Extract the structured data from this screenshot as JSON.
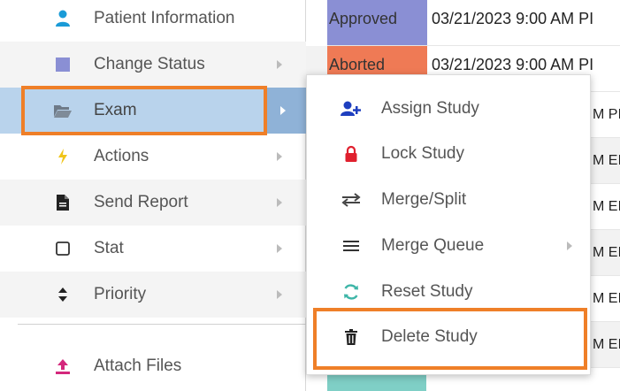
{
  "colors": {
    "approved": "#8a8fd4",
    "aborted": "#ef7a55",
    "active_item": "#b9d3ec",
    "highlight": "#ef7f28",
    "teal": "#7fcfc6"
  },
  "grid": {
    "rows": [
      {
        "status": "Approved",
        "date": "03/21/2023 9:00 AM PI"
      },
      {
        "status": "Aborted",
        "date": "03/21/2023 9:00 AM PI"
      },
      {
        "status": "",
        "date": "",
        "tail": "M PI"
      },
      {
        "status": "",
        "date": "",
        "tail": "M EI"
      },
      {
        "status": "",
        "date": "",
        "tail": "M EI"
      },
      {
        "status": "",
        "date": "",
        "tail": "M EI"
      },
      {
        "status": "",
        "date": "",
        "tail": "M EI"
      },
      {
        "status": "",
        "date": "",
        "tail": "M EI"
      }
    ]
  },
  "menu": {
    "items": [
      {
        "label": "Patient Information",
        "icon": "person-icon",
        "has_submenu": false
      },
      {
        "label": "Change Status",
        "icon": "square-icon",
        "has_submenu": true
      },
      {
        "label": "Exam",
        "icon": "folder-open-icon",
        "has_submenu": true,
        "active": true
      },
      {
        "label": "Actions",
        "icon": "lightning-icon",
        "has_submenu": true
      },
      {
        "label": "Send Report",
        "icon": "document-icon",
        "has_submenu": true
      },
      {
        "label": "Stat",
        "icon": "checkbox-icon",
        "has_submenu": true
      },
      {
        "label": "Priority",
        "icon": "sort-icon",
        "has_submenu": true
      }
    ],
    "footer_item": {
      "label": "Attach Files",
      "icon": "upload-icon"
    }
  },
  "submenu": {
    "items": [
      {
        "label": "Assign Study",
        "icon": "add-user-icon"
      },
      {
        "label": "Lock Study",
        "icon": "lock-icon"
      },
      {
        "label": "Merge/Split",
        "icon": "swap-icon"
      },
      {
        "label": "Merge Queue",
        "icon": "list-icon",
        "has_submenu": true
      },
      {
        "label": "Reset Study",
        "icon": "refresh-icon"
      },
      {
        "label": "Delete Study",
        "icon": "trash-icon"
      }
    ]
  }
}
